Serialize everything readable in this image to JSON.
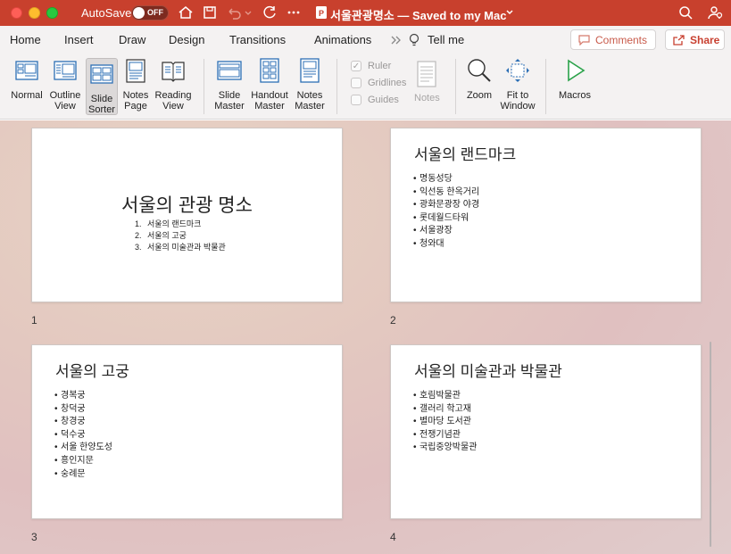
{
  "titlebar": {
    "autosave_label": "AutoSave",
    "autosave_state": "OFF",
    "doc_title": "서울관광명소 — Saved to my Mac"
  },
  "menu": {
    "tabs": [
      "Home",
      "Insert",
      "Draw",
      "Design",
      "Transitions",
      "Animations"
    ],
    "tell_me": "Tell me",
    "comments": "Comments",
    "share": "Share"
  },
  "ribbon": {
    "views": [
      {
        "line1": "Normal",
        "line2": ""
      },
      {
        "line1": "Outline",
        "line2": "View"
      },
      {
        "line1": "Slide",
        "line2": "Sorter"
      },
      {
        "line1": "Notes",
        "line2": "Page"
      },
      {
        "line1": "Reading",
        "line2": "View"
      }
    ],
    "masters": [
      {
        "line1": "Slide",
        "line2": "Master"
      },
      {
        "line1": "Handout",
        "line2": "Master"
      },
      {
        "line1": "Notes",
        "line2": "Master"
      }
    ],
    "checks": {
      "ruler": "Ruler",
      "gridlines": "Gridlines",
      "guides": "Guides"
    },
    "notes": "Notes",
    "zoom": "Zoom",
    "fit_line1": "Fit to",
    "fit_line2": "Window",
    "macros": "Macros"
  },
  "slides": [
    {
      "number": "1",
      "title": "서울의 관광 명소",
      "items": [
        {
          "n": "1.",
          "t": "서울의 랜드마크"
        },
        {
          "n": "2.",
          "t": "서울의 고궁"
        },
        {
          "n": "3.",
          "t": "서울의 미술관과 박물관"
        }
      ]
    },
    {
      "number": "2",
      "title": "서울의 랜드마크",
      "items": [
        "명동성당",
        "익선동 한옥거리",
        "광화문광장 야경",
        "롯데월드타워",
        "서울광장",
        "청와대"
      ]
    },
    {
      "number": "3",
      "title": "서울의 고궁",
      "items": [
        "경복궁",
        "창덕궁",
        "창경궁",
        "덕수궁",
        "서울 한양도성",
        "흥인지문",
        "숭례문"
      ]
    },
    {
      "number": "4",
      "title": "서울의 미술관과 박물관",
      "items": [
        "호림박물관",
        "갤러리 학고재",
        "별마당 도서관",
        "전쟁기념관",
        "국립중앙박물관"
      ]
    }
  ]
}
